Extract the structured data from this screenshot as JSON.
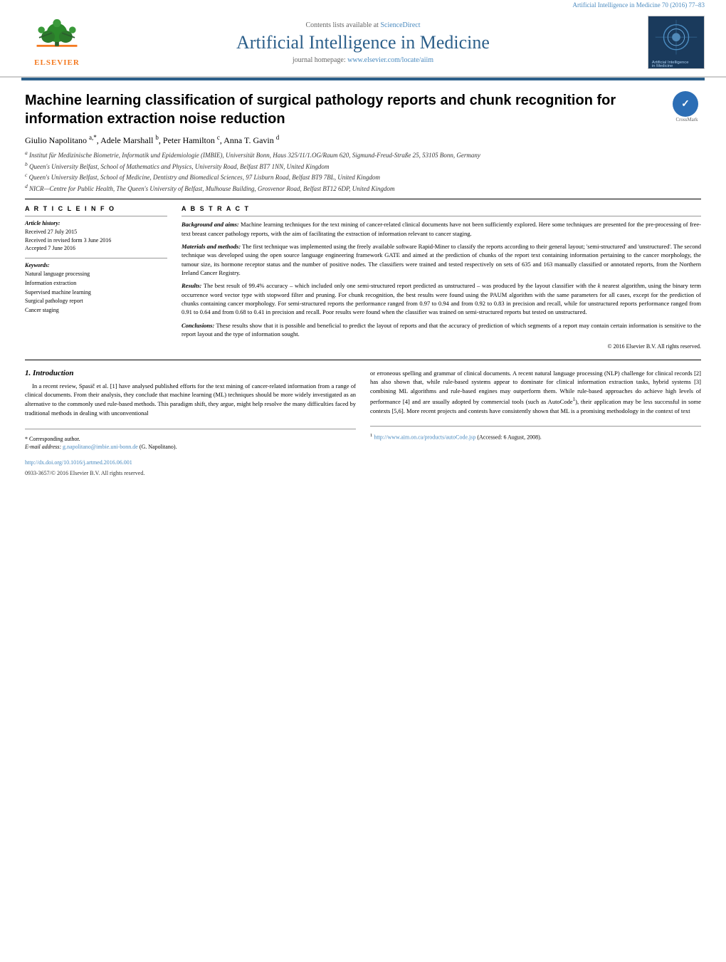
{
  "header": {
    "journal_citation": "Artificial Intelligence in Medicine 70 (2016) 77–83",
    "contents_label": "Contents lists available at",
    "sciencedirect_link": "ScienceDirect",
    "journal_title": "Artificial Intelligence in Medicine",
    "homepage_label": "journal homepage:",
    "homepage_url": "www.elsevier.com/locate/aiim",
    "elsevier_text": "ELSEVIER"
  },
  "article": {
    "title": "Machine learning classification of surgical pathology reports and chunk recognition for information extraction noise reduction",
    "authors": "Giulio Napolitano a,*, Adele Marshall b, Peter Hamilton c, Anna T. Gavin d",
    "author_list": [
      {
        "name": "Giulio Napolitano",
        "sup": "a,*"
      },
      {
        "name": "Adele Marshall",
        "sup": "b"
      },
      {
        "name": "Peter Hamilton",
        "sup": "c"
      },
      {
        "name": "Anna T. Gavin",
        "sup": "d"
      }
    ],
    "affiliations": [
      {
        "sup": "a",
        "text": "Institut für Medizinische Biometrie, Informatik und Epidemiologie (IMBIE), Universität Bonn, Haus 325/11/1.OG/Raum 620, Sigmund-Freud-Straße 25, 53105 Bonn, Germany"
      },
      {
        "sup": "b",
        "text": "Queen's University Belfast, School of Mathematics and Physics, University Road, Belfast BT7 1NN, United Kingdom"
      },
      {
        "sup": "c",
        "text": "Queen's University Belfast, School of Medicine, Dentistry and Biomedical Sciences, 97 Lisburn Road, Belfast BT9 7BL, United Kingdom"
      },
      {
        "sup": "d",
        "text": "NICR—Centre for Public Health, The Queen's University of Belfast, Mulhouse Building, Grosvenor Road, Belfast BT12 6DP, United Kingdom"
      }
    ]
  },
  "article_info": {
    "section_label": "A R T I C L E   I N F O",
    "history_label": "Article history:",
    "received": "Received 27 July 2015",
    "received_revised": "Received in revised form 3 June 2016",
    "accepted": "Accepted 7 June 2016",
    "keywords_label": "Keywords:",
    "keywords": [
      "Natural language processing",
      "Information extraction",
      "Supervised machine learning",
      "Surgical pathology report",
      "Cancer staging"
    ]
  },
  "abstract": {
    "section_label": "A B S T R A C T",
    "paragraphs": [
      {
        "label": "Background and aims:",
        "text": " Machine learning techniques for the text mining of cancer-related clinical documents have not been sufficiently explored. Here some techniques are presented for the pre-processing of free-text breast cancer pathology reports, with the aim of facilitating the extraction of information relevant to cancer staging."
      },
      {
        "label": "Materials and methods:",
        "text": " The first technique was implemented using the freely available software Rapid-Miner to classify the reports according to their general layout; 'semi-structured' and 'unstructured'. The second technique was developed using the open source language engineering framework GATE and aimed at the prediction of chunks of the report text containing information pertaining to the cancer morphology, the tumour size, its hormone receptor status and the number of positive nodes. The classifiers were trained and tested respectively on sets of 635 and 163 manually classified or annotated reports, from the Northern Ireland Cancer Registry."
      },
      {
        "label": "Results:",
        "text": " The best result of 99.4% accuracy – which included only one semi-structured report predicted as unstructured – was produced by the layout classifier with the k nearest algorithm, using the binary term occurrence word vector type with stopword filter and pruning. For chunk recognition, the best results were found using the PAUM algorithm with the same parameters for all cases, except for the prediction of chunks containing cancer morphology. For semi-structured reports the performance ranged from 0.97 to 0.94 and from 0.92 to 0.83 in precision and recall, while for unstructured reports performance ranged from 0.91 to 0.64 and from 0.68 to 0.41 in precision and recall. Poor results were found when the classifier was trained on semi-structured reports but tested on unstructured."
      },
      {
        "label": "Conclusions:",
        "text": " These results show that it is possible and beneficial to predict the layout of reports and that the accuracy of prediction of which segments of a report may contain certain information is sensitive to the report layout and the type of information sought."
      }
    ],
    "copyright": "© 2016 Elsevier B.V. All rights reserved."
  },
  "body": {
    "section1_title": "1.  Introduction",
    "left_paragraph1": "In a recent review, Spasič et al. [1] have analysed published efforts for the text mining of cancer-related information from a range of clinical documents. From their analysis, they conclude that machine learning (ML) techniques should be more widely investigated as an alternative to the commonly used rule-based methods. This paradigm shift, they argue, might help resolve the many difficulties faced by traditional methods in dealing with unconventional",
    "right_paragraph1": "or erroneous spelling and grammar of clinical documents. A recent natural language processing (NLP) challenge for clinical records [2] has also shown that, while rule-based systems appear to dominate for clinical information extraction tasks, hybrid systems [3] combining ML algorithms and rule-based engines may outperform them. While rule-based approaches do achieve high levels of performance [4] and are usually adopted by commercial tools (such as AutoCode",
    "right_paragraph1_cont": "), their application may be less successful in some contexts [5,6]. More recent projects and contests have consistently shown that ML is a promising methodology in the context of text",
    "footnote_left_label": "* Corresponding author.",
    "footnote_left_email_label": "E-mail address:",
    "footnote_left_email": "g.napolitano@imbie.uni-bonn.de",
    "footnote_left_name": "(G. Napolitano).",
    "footnote_right_1": "1",
    "footnote_right_url": "http://www.aim.on.ca/products/autoCode.jsp",
    "footnote_right_accessed": "(Accessed: 6 August, 2008).",
    "doi": "http://dx.doi.org/10.1016/j.artmed.2016.06.001",
    "issn": "0933-3657/© 2016 Elsevier B.V. All rights reserved.",
    "while_word": "while"
  }
}
